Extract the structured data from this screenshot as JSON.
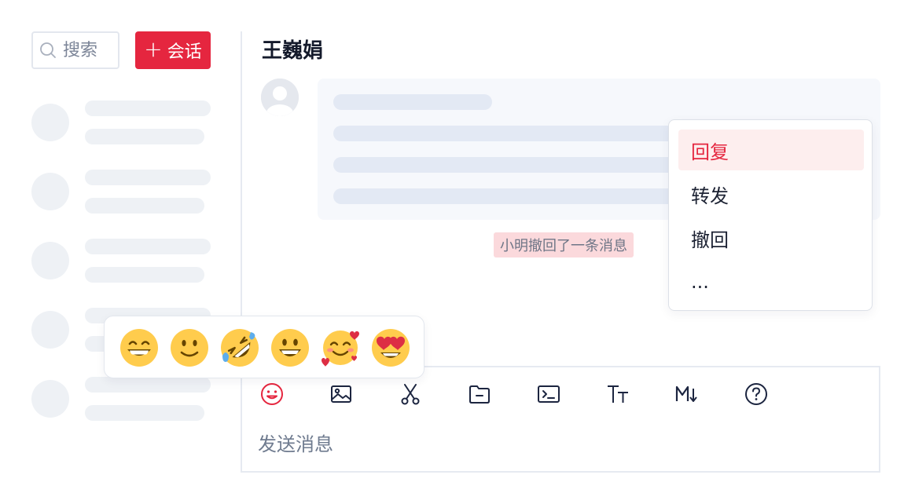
{
  "sidebar": {
    "search_placeholder": "搜索",
    "new_chat_label": "会话",
    "new_chat_icon": "plus-icon",
    "accent_color": "#e5263f",
    "conversation_items_count_visible": 5
  },
  "chat": {
    "title": "王巍娟",
    "recall_notice": "小明撤回了一条消息"
  },
  "context_menu": {
    "items": [
      {
        "label": "回复",
        "active": true
      },
      {
        "label": "转发",
        "active": false
      },
      {
        "label": "撤回",
        "active": false
      },
      {
        "label": "...",
        "active": false
      }
    ]
  },
  "emoji_picker": {
    "emojis": [
      "grinning-face-with-smiling-eyes",
      "slightly-smiling-face",
      "rolling-on-the-floor-laughing",
      "grinning-face-with-big-eyes",
      "smiling-face-with-hearts",
      "smiling-face-with-heart-eyes"
    ]
  },
  "composer": {
    "placeholder": "发送消息",
    "toolbar": [
      "emoji-icon",
      "image-icon",
      "scissors-icon",
      "folder-icon",
      "terminal-icon",
      "text-size-icon",
      "markdown-icon",
      "help-icon"
    ]
  }
}
